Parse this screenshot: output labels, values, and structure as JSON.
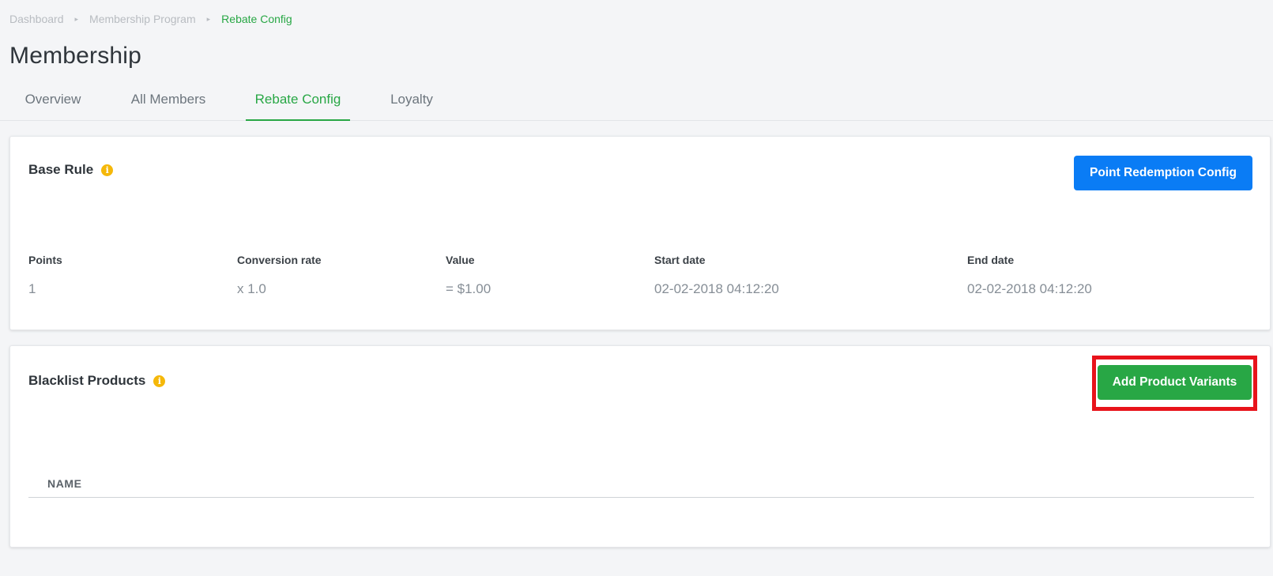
{
  "breadcrumb": {
    "items": [
      "Dashboard",
      "Membership Program",
      "Rebate Config"
    ],
    "separator": "▸"
  },
  "page": {
    "title": "Membership"
  },
  "tabs": [
    {
      "label": "Overview",
      "active": false
    },
    {
      "label": "All Members",
      "active": false
    },
    {
      "label": "Rebate Config",
      "active": true
    },
    {
      "label": "Loyalty",
      "active": false
    }
  ],
  "base_rule": {
    "title": "Base Rule",
    "info_icon": "info-circle-icon",
    "button_label": "Point Redemption Config",
    "fields": [
      {
        "label": "Points",
        "value": "1"
      },
      {
        "label": "Conversion rate",
        "value": "x 1.0"
      },
      {
        "label": "Value",
        "value": "= $1.00"
      },
      {
        "label": "Start date",
        "value": "02-02-2018 04:12:20"
      },
      {
        "label": "End date",
        "value": "02-02-2018 04:12:20"
      }
    ]
  },
  "blacklist": {
    "title": "Blacklist Products",
    "info_icon": "info-circle-icon",
    "button_label": "Add Product Variants",
    "columns": [
      "NAME"
    ]
  },
  "colors": {
    "accent_green": "#28a745",
    "primary_blue": "#0a7cf5",
    "info_yellow": "#f5b80a",
    "highlight_red": "#e8131b"
  }
}
